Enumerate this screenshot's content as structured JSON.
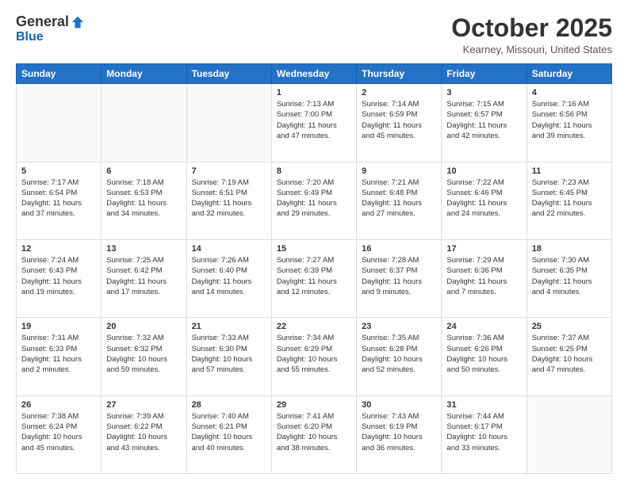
{
  "header": {
    "logo_general": "General",
    "logo_blue": "Blue",
    "month_title": "October 2025",
    "location": "Kearney, Missouri, United States"
  },
  "days_of_week": [
    "Sunday",
    "Monday",
    "Tuesday",
    "Wednesday",
    "Thursday",
    "Friday",
    "Saturday"
  ],
  "weeks": [
    [
      {
        "day": "",
        "info": ""
      },
      {
        "day": "",
        "info": ""
      },
      {
        "day": "",
        "info": ""
      },
      {
        "day": "1",
        "info": "Sunrise: 7:13 AM\nSunset: 7:00 PM\nDaylight: 11 hours and 47 minutes."
      },
      {
        "day": "2",
        "info": "Sunrise: 7:14 AM\nSunset: 6:59 PM\nDaylight: 11 hours and 45 minutes."
      },
      {
        "day": "3",
        "info": "Sunrise: 7:15 AM\nSunset: 6:57 PM\nDaylight: 11 hours and 42 minutes."
      },
      {
        "day": "4",
        "info": "Sunrise: 7:16 AM\nSunset: 6:56 PM\nDaylight: 11 hours and 39 minutes."
      }
    ],
    [
      {
        "day": "5",
        "info": "Sunrise: 7:17 AM\nSunset: 6:54 PM\nDaylight: 11 hours and 37 minutes."
      },
      {
        "day": "6",
        "info": "Sunrise: 7:18 AM\nSunset: 6:53 PM\nDaylight: 11 hours and 34 minutes."
      },
      {
        "day": "7",
        "info": "Sunrise: 7:19 AM\nSunset: 6:51 PM\nDaylight: 11 hours and 32 minutes."
      },
      {
        "day": "8",
        "info": "Sunrise: 7:20 AM\nSunset: 6:49 PM\nDaylight: 11 hours and 29 minutes."
      },
      {
        "day": "9",
        "info": "Sunrise: 7:21 AM\nSunset: 6:48 PM\nDaylight: 11 hours and 27 minutes."
      },
      {
        "day": "10",
        "info": "Sunrise: 7:22 AM\nSunset: 6:46 PM\nDaylight: 11 hours and 24 minutes."
      },
      {
        "day": "11",
        "info": "Sunrise: 7:23 AM\nSunset: 6:45 PM\nDaylight: 11 hours and 22 minutes."
      }
    ],
    [
      {
        "day": "12",
        "info": "Sunrise: 7:24 AM\nSunset: 6:43 PM\nDaylight: 11 hours and 19 minutes."
      },
      {
        "day": "13",
        "info": "Sunrise: 7:25 AM\nSunset: 6:42 PM\nDaylight: 11 hours and 17 minutes."
      },
      {
        "day": "14",
        "info": "Sunrise: 7:26 AM\nSunset: 6:40 PM\nDaylight: 11 hours and 14 minutes."
      },
      {
        "day": "15",
        "info": "Sunrise: 7:27 AM\nSunset: 6:39 PM\nDaylight: 11 hours and 12 minutes."
      },
      {
        "day": "16",
        "info": "Sunrise: 7:28 AM\nSunset: 6:37 PM\nDaylight: 11 hours and 9 minutes."
      },
      {
        "day": "17",
        "info": "Sunrise: 7:29 AM\nSunset: 6:36 PM\nDaylight: 11 hours and 7 minutes."
      },
      {
        "day": "18",
        "info": "Sunrise: 7:30 AM\nSunset: 6:35 PM\nDaylight: 11 hours and 4 minutes."
      }
    ],
    [
      {
        "day": "19",
        "info": "Sunrise: 7:31 AM\nSunset: 6:33 PM\nDaylight: 11 hours and 2 minutes."
      },
      {
        "day": "20",
        "info": "Sunrise: 7:32 AM\nSunset: 6:32 PM\nDaylight: 10 hours and 59 minutes."
      },
      {
        "day": "21",
        "info": "Sunrise: 7:33 AM\nSunset: 6:30 PM\nDaylight: 10 hours and 57 minutes."
      },
      {
        "day": "22",
        "info": "Sunrise: 7:34 AM\nSunset: 6:29 PM\nDaylight: 10 hours and 55 minutes."
      },
      {
        "day": "23",
        "info": "Sunrise: 7:35 AM\nSunset: 6:28 PM\nDaylight: 10 hours and 52 minutes."
      },
      {
        "day": "24",
        "info": "Sunrise: 7:36 AM\nSunset: 6:26 PM\nDaylight: 10 hours and 50 minutes."
      },
      {
        "day": "25",
        "info": "Sunrise: 7:37 AM\nSunset: 6:25 PM\nDaylight: 10 hours and 47 minutes."
      }
    ],
    [
      {
        "day": "26",
        "info": "Sunrise: 7:38 AM\nSunset: 6:24 PM\nDaylight: 10 hours and 45 minutes."
      },
      {
        "day": "27",
        "info": "Sunrise: 7:39 AM\nSunset: 6:22 PM\nDaylight: 10 hours and 43 minutes."
      },
      {
        "day": "28",
        "info": "Sunrise: 7:40 AM\nSunset: 6:21 PM\nDaylight: 10 hours and 40 minutes."
      },
      {
        "day": "29",
        "info": "Sunrise: 7:41 AM\nSunset: 6:20 PM\nDaylight: 10 hours and 38 minutes."
      },
      {
        "day": "30",
        "info": "Sunrise: 7:43 AM\nSunset: 6:19 PM\nDaylight: 10 hours and 36 minutes."
      },
      {
        "day": "31",
        "info": "Sunrise: 7:44 AM\nSunset: 6:17 PM\nDaylight: 10 hours and 33 minutes."
      },
      {
        "day": "",
        "info": ""
      }
    ]
  ]
}
